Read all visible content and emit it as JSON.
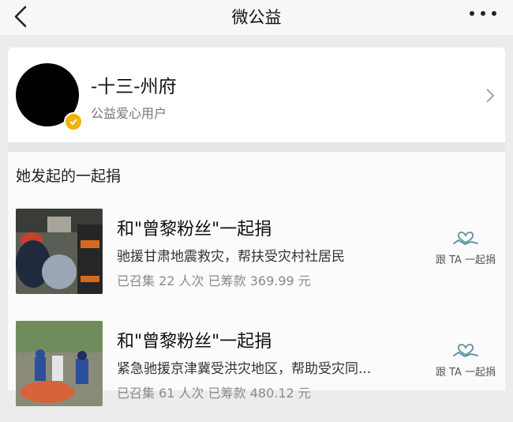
{
  "nav": {
    "title": "微公益"
  },
  "profile": {
    "name": "-十三-州府",
    "tag": "公益爱心用户"
  },
  "section": {
    "title": "她发起的一起捐"
  },
  "campaigns": [
    {
      "title": "和\"曾黎粉丝\"一起捐",
      "desc": "驰援甘肃地震救灾，帮扶受灾村社居民",
      "stats": "已召集 22 人次 已筹款 369.99 元",
      "join_label": "跟 TA 一起捐"
    },
    {
      "title": "和\"曾黎粉丝\"一起捐",
      "desc": "紧急驰援京津冀受洪灾地区，帮助受灾同...",
      "stats": "已召集 61 人次 已筹款 480.12 元",
      "join_label": "跟 TA 一起捐"
    }
  ],
  "colors": {
    "accent": "#5a8fa0",
    "badge": "#f0b400",
    "background": "#ececec"
  },
  "icons": [
    "back-arrow-icon",
    "more-dots-icon",
    "verified-badge-icon",
    "chevron-right-icon",
    "heart-hand-icon"
  ]
}
